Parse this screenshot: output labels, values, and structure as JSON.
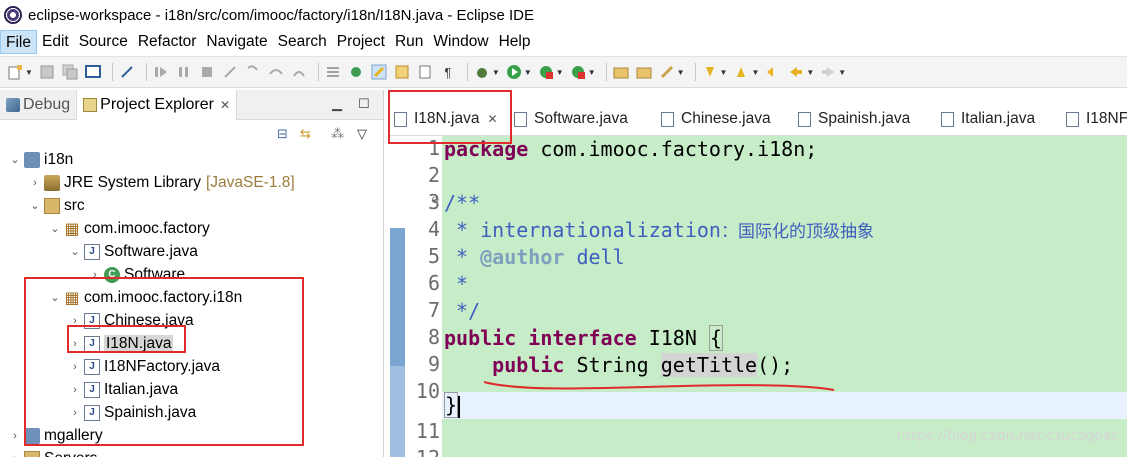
{
  "window": {
    "title": "eclipse-workspace - i18n/src/com/imooc/factory/i18n/I18N.java - Eclipse IDE"
  },
  "menu": [
    "File",
    "Edit",
    "Source",
    "Refactor",
    "Navigate",
    "Search",
    "Project",
    "Run",
    "Window",
    "Help"
  ],
  "left_panel": {
    "tabs": [
      {
        "label": "Debug",
        "active": false
      },
      {
        "label": "Project Explorer",
        "active": true
      }
    ],
    "tree": [
      {
        "label": "i18n",
        "twist": "⌄",
        "icon": "project",
        "indent": 0
      },
      {
        "label": "JRE System Library",
        "suffix": "[JavaSE-1.8]",
        "twist": "›",
        "icon": "jar",
        "indent": 1
      },
      {
        "label": "src",
        "twist": "⌄",
        "icon": "src",
        "indent": 1
      },
      {
        "label": "com.imooc.factory",
        "twist": "⌄",
        "icon": "package",
        "indent": 2
      },
      {
        "label": "Software.java",
        "twist": "⌄",
        "icon": "java",
        "indent": 3
      },
      {
        "label": "Software",
        "twist": "›",
        "icon": "class",
        "indent": 4
      },
      {
        "label": "com.imooc.factory.i18n",
        "twist": "⌄",
        "icon": "package",
        "indent": 2
      },
      {
        "label": "Chinese.java",
        "twist": "›",
        "icon": "java",
        "indent": 3
      },
      {
        "label": "I18N.java",
        "twist": "›",
        "icon": "java",
        "indent": 3,
        "selected": true
      },
      {
        "label": "I18NFactory.java",
        "twist": "›",
        "icon": "java",
        "indent": 3
      },
      {
        "label": "Italian.java",
        "twist": "›",
        "icon": "java",
        "indent": 3
      },
      {
        "label": "Spainish.java",
        "twist": "›",
        "icon": "java",
        "indent": 3
      },
      {
        "label": "mgallery",
        "twist": "›",
        "icon": "project",
        "indent": 0
      },
      {
        "label": "Servers",
        "twist": "›",
        "icon": "src",
        "indent": 0
      }
    ]
  },
  "editor": {
    "tabs": [
      {
        "label": "I18N.java",
        "active": true,
        "closable": true
      },
      {
        "label": "Software.java"
      },
      {
        "label": "Chinese.java"
      },
      {
        "label": "Spainish.java"
      },
      {
        "label": "Italian.java"
      },
      {
        "label": "I18NF"
      }
    ],
    "line_numbers": [
      "1",
      "2",
      "3",
      "4",
      "5",
      "6",
      "7",
      "8",
      "9",
      "10",
      "11",
      "12"
    ],
    "code": {
      "l1_kw": "package",
      "l1_rest": " com.imooc.factory.i18n;",
      "l3": "/**",
      "l4_pre": " * internationalization",
      "l4_cn": "：国际化的顶级抽象",
      "l5_pre": " * ",
      "l5_tag": "@author",
      "l5_rest": " dell",
      "l6": " *",
      "l7": " */",
      "l8_kw1": "public",
      "l8_kw2": "interface",
      "l8_rest": " I18N ",
      "l8_brace": "{",
      "l9_indent": "    ",
      "l9_kw": "public",
      "l9_type": " String ",
      "l9_method": "getTitle",
      "l9_rest": "();",
      "l11_brace": "}"
    }
  },
  "watermark": "https://blog.csdn.net/csucsgoat",
  "colors": {
    "code_bg": "#c6ecc8",
    "keyword": "#7f0055",
    "javadoc": "#3f5fbf",
    "annotation_red": "#e02b2b"
  }
}
